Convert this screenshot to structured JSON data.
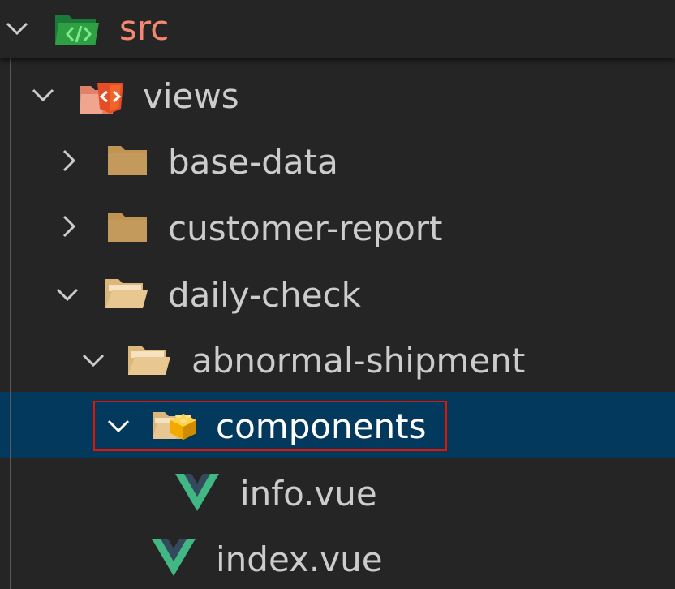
{
  "explorer": {
    "items": [
      {
        "label": "src",
        "expanded": true,
        "icon": "folder-src-open-icon"
      },
      {
        "label": "views",
        "expanded": true,
        "icon": "folder-views-open-icon"
      },
      {
        "label": "base-data",
        "expanded": false,
        "icon": "folder-closed-icon"
      },
      {
        "label": "customer-report",
        "expanded": false,
        "icon": "folder-closed-icon"
      },
      {
        "label": "daily-check",
        "expanded": true,
        "icon": "folder-open-icon"
      },
      {
        "label": "abnormal-shipment",
        "expanded": true,
        "icon": "folder-open-icon"
      },
      {
        "label": "components",
        "expanded": true,
        "selected": true,
        "icon": "folder-components-open-icon"
      },
      {
        "label": "info.vue",
        "icon": "vue-icon"
      },
      {
        "label": "index.vue",
        "icon": "vue-icon"
      }
    ]
  },
  "colors": {
    "background": "#252526",
    "selected_row": "#04395e",
    "highlight_border": "#e51400",
    "src_label": "#f48771",
    "folder_closed": "#c09553",
    "vue_green": "#41b883",
    "vue_dark": "#35495e"
  }
}
